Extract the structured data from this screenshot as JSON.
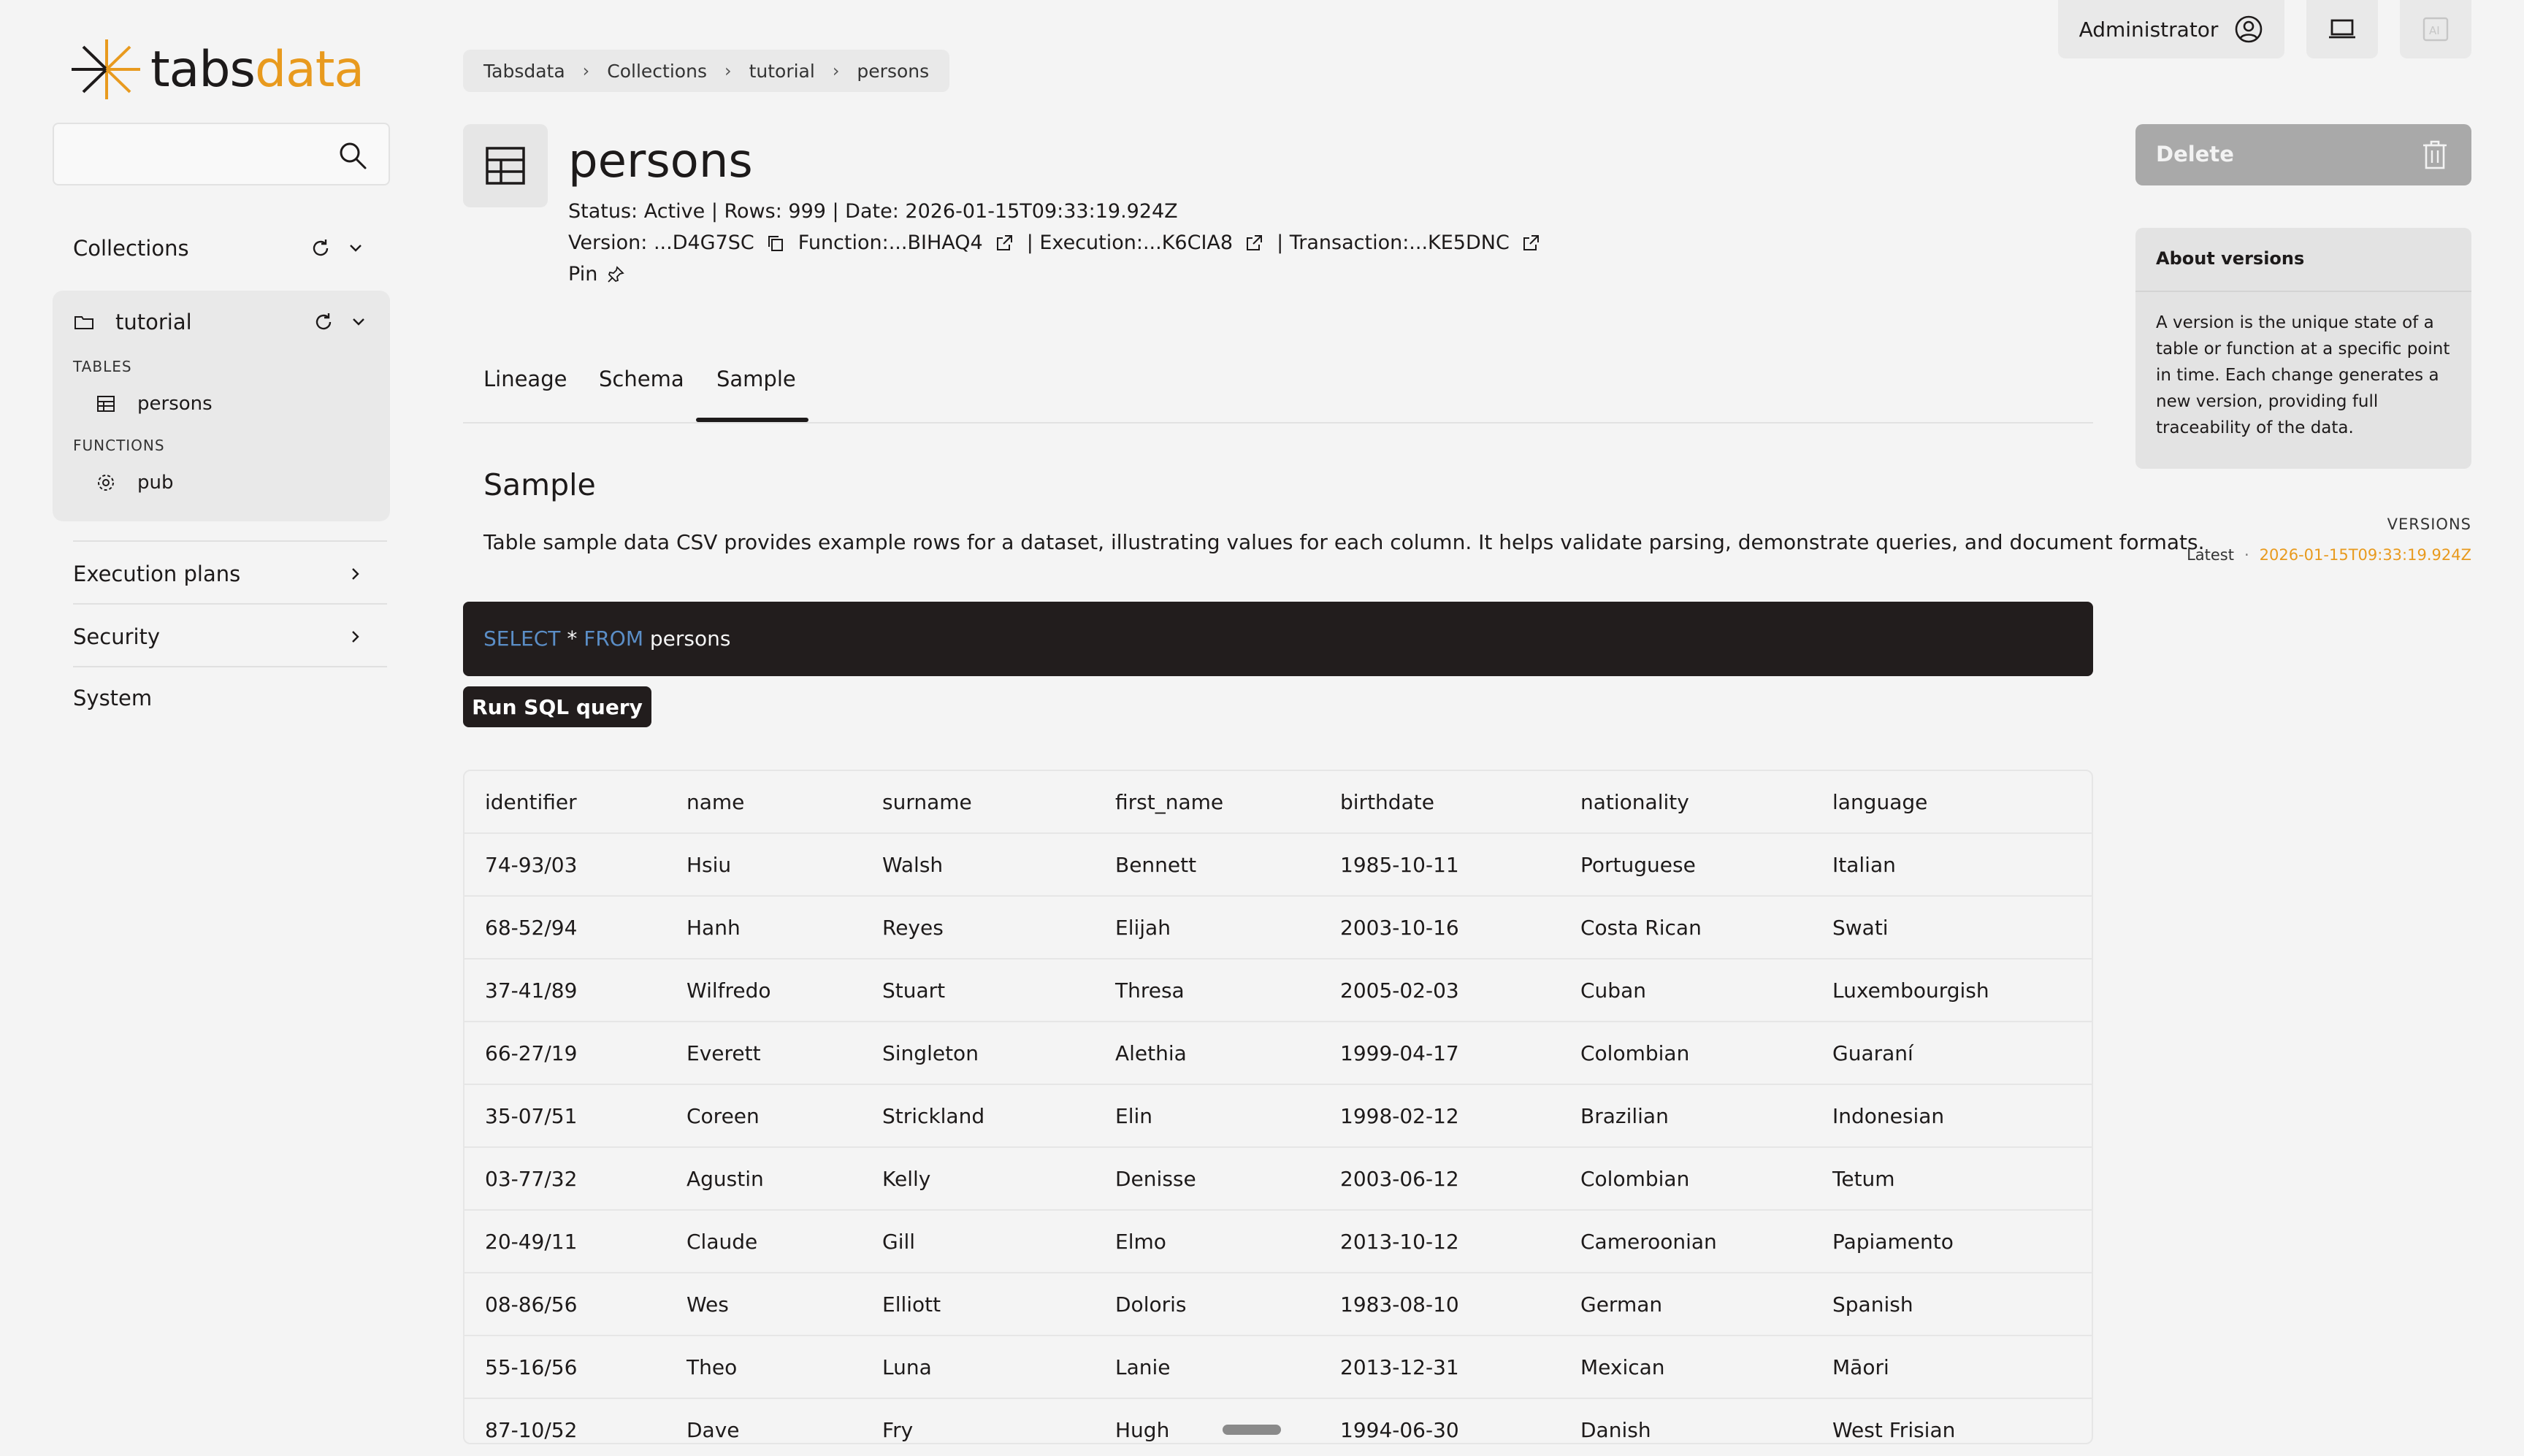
{
  "brand": {
    "name_part1": "tabs",
    "name_part2": "data"
  },
  "search": {
    "placeholder": ""
  },
  "sidebar": {
    "collections_label": "Collections",
    "collection": {
      "name": "tutorial",
      "tables_header": "TABLES",
      "tables": [
        "persons"
      ],
      "functions_header": "FUNCTIONS",
      "functions": [
        "pub"
      ]
    },
    "execution_plans_label": "Execution plans",
    "security_label": "Security",
    "system_label": "System"
  },
  "breadcrumb": [
    "Tabsdata",
    "Collections",
    "tutorial",
    "persons"
  ],
  "header": {
    "title": "persons",
    "status_line": "Status: Active | Rows: 999 | Date: 2026-01-15T09:33:19.924Z",
    "version": "Version: ...D4G7SC",
    "function": "Function:...BIHAQ4",
    "execution": "| Execution:...K6CIA8",
    "transaction": "| Transaction:...KE5DNC",
    "pin": "Pin"
  },
  "tabs": [
    "Lineage",
    "Schema",
    "Sample"
  ],
  "active_tab": "Sample",
  "sample": {
    "heading": "Sample",
    "description": "Table sample data CSV provides example rows for a dataset, illustrating values for each column. It helps validate parsing, demonstrate queries, and document formats.",
    "sql": {
      "kw1": "SELECT",
      "star": " * ",
      "kw2": "FROM",
      "table": " persons"
    },
    "run_label": "Run SQL query"
  },
  "table": {
    "columns": [
      "identifier",
      "name",
      "surname",
      "first_name",
      "birthdate",
      "nationality",
      "language"
    ],
    "rows": [
      [
        "74-93/03",
        "Hsiu",
        "Walsh",
        "Bennett",
        "1985-10-11",
        "Portuguese",
        "Italian"
      ],
      [
        "68-52/94",
        "Hanh",
        "Reyes",
        "Elijah",
        "2003-10-16",
        "Costa Rican",
        "Swati"
      ],
      [
        "37-41/89",
        "Wilfredo",
        "Stuart",
        "Thresa",
        "2005-02-03",
        "Cuban",
        "Luxembourgish"
      ],
      [
        "66-27/19",
        "Everett",
        "Singleton",
        "Alethia",
        "1999-04-17",
        "Colombian",
        "Guaraní"
      ],
      [
        "35-07/51",
        "Coreen",
        "Strickland",
        "Elin",
        "1998-02-12",
        "Brazilian",
        "Indonesian"
      ],
      [
        "03-77/32",
        "Agustin",
        "Kelly",
        "Denisse",
        "2003-06-12",
        "Colombian",
        "Tetum"
      ],
      [
        "20-49/11",
        "Claude",
        "Gill",
        "Elmo",
        "2013-10-12",
        "Cameroonian",
        "Papiamento"
      ],
      [
        "08-86/56",
        "Wes",
        "Elliott",
        "Doloris",
        "1983-08-10",
        "German",
        "Spanish"
      ],
      [
        "55-16/56",
        "Theo",
        "Luna",
        "Lanie",
        "2013-12-31",
        "Mexican",
        "Māori"
      ],
      [
        "87-10/52",
        "Dave",
        "Fry",
        "Hugh",
        "1994-06-30",
        "Danish",
        "West Frisian"
      ]
    ]
  },
  "topbar": {
    "user_label": "Administrator",
    "ai_label": "AI"
  },
  "right": {
    "delete_label": "Delete",
    "about_title": "About versions",
    "about_body": "A version is the unique state of a table or function at a specific point in time. Each change generates a new version, providing full traceability of the data.",
    "versions_header": "VERSIONS",
    "latest_label": "Latest",
    "latest_separator": "·",
    "latest_date": "2026-01-15T09:33:19.924Z"
  },
  "colors": {
    "accent": "#e89a1e",
    "dark": "#221d1d",
    "sql_keyword": "#5b8ec7"
  }
}
